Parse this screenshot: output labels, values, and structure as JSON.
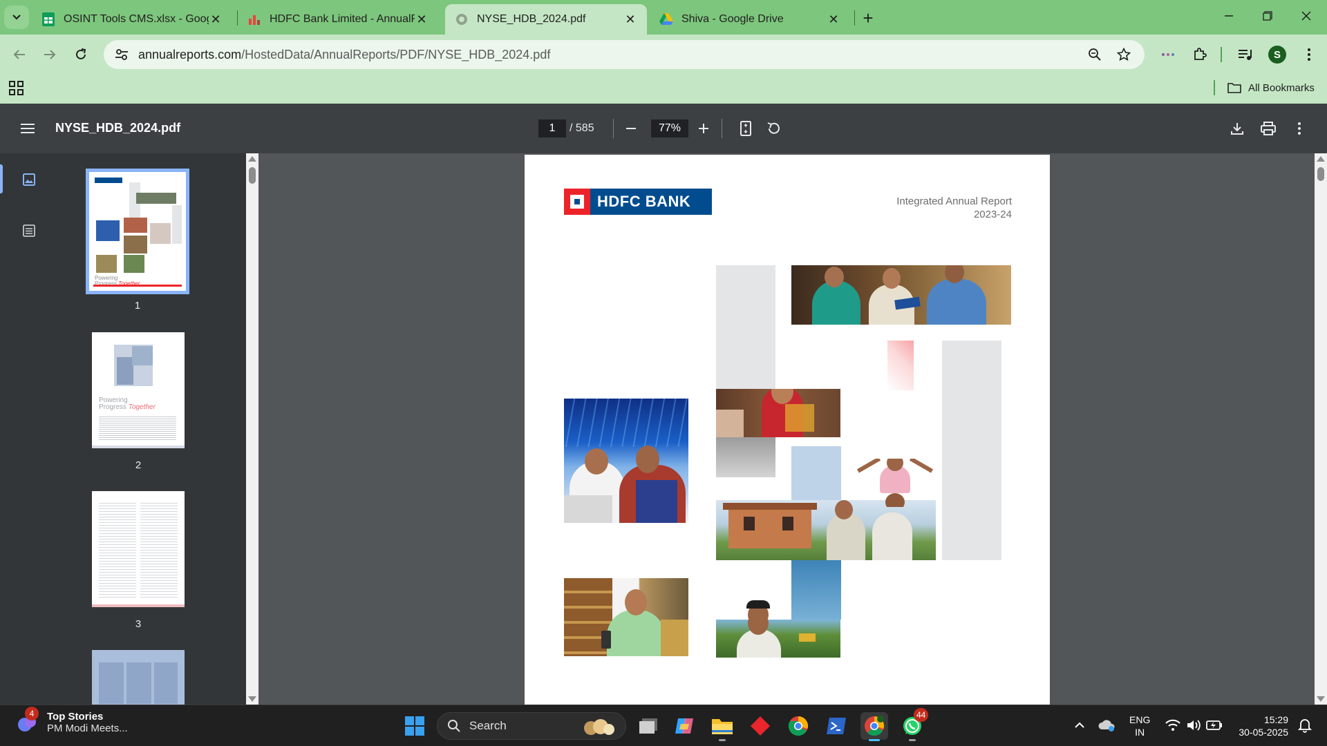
{
  "browser": {
    "tabs": [
      {
        "title": "OSINT Tools CMS.xlsx - Google",
        "icon": "google-sheets-icon",
        "active": false
      },
      {
        "title": "HDFC Bank Limited - AnnualRe",
        "icon": "bar-chart-icon",
        "active": false
      },
      {
        "title": "NYSE_HDB_2024.pdf",
        "icon": "globe-icon",
        "active": true
      },
      {
        "title": "Shiva - Google Drive",
        "icon": "google-drive-icon",
        "active": false
      }
    ],
    "address": {
      "host": "annualreports.com",
      "path": "/HostedData/AnnualReports/PDF/NYSE_HDB_2024.pdf"
    },
    "profile_initial": "S",
    "bookmarks_label": "All Bookmarks",
    "theme_color": "#7dc67d"
  },
  "pdf_viewer": {
    "filename": "NYSE_HDB_2024.pdf",
    "current_page": "1",
    "total_pages": "/ 585",
    "zoom": "77%",
    "thumbnails": [
      {
        "label": "1",
        "selected": true
      },
      {
        "label": "2",
        "selected": false
      },
      {
        "label": "3",
        "selected": false
      }
    ],
    "thumbnail_text": {
      "t1_powering": "Powering",
      "t1_progress": "Progress",
      "t1_together": "Together",
      "t2_powering": "Powering",
      "t2_progress": "Progress",
      "t2_together": "Together"
    }
  },
  "document": {
    "logo_text": "HDFC BANK",
    "report_title_line1": "Integrated Annual Report",
    "report_title_line2": "2023-24",
    "brand_colors": {
      "blue": "#004c8f",
      "red": "#ed232a"
    }
  },
  "taskbar": {
    "news_badge": "4",
    "news_title": "Top Stories",
    "news_subtitle": "PM Modi Meets...",
    "search_label": "Search",
    "whatsapp_badge": "44",
    "language": "ENG",
    "region": "IN",
    "time": "15:29",
    "date": "30-05-2025"
  }
}
